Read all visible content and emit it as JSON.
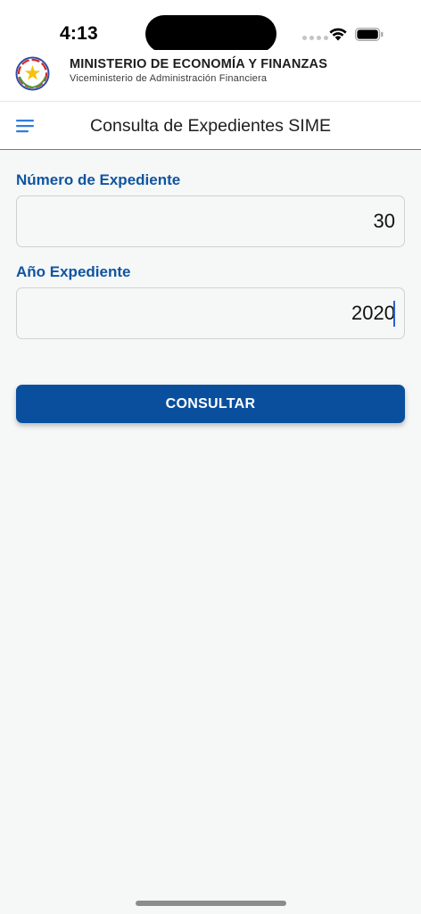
{
  "status_bar": {
    "time": "4:13",
    "icons": [
      "cellular-signal-icon",
      "wifi-icon",
      "battery-icon"
    ]
  },
  "header": {
    "logo_icon": "national-seal-icon",
    "ministry_name": "MINISTERIO DE ECONOMÍA Y FINANZAS",
    "ministry_subtitle": "Viceministerio de Administración Financiera"
  },
  "app_bar": {
    "menu_icon": "hamburger-menu-icon",
    "title": "Consulta de Expedientes SIME",
    "accent_line_color": "#d9534f"
  },
  "form": {
    "expediente_number": {
      "label": "Número de Expediente",
      "value": "30"
    },
    "expediente_year": {
      "label": "Año Expediente",
      "value": "2020"
    },
    "submit_label": "CONSULTAR"
  },
  "colors": {
    "label_blue": "#0f55a1",
    "button_blue": "#0a4f9e",
    "background": "#f6f7f7"
  }
}
